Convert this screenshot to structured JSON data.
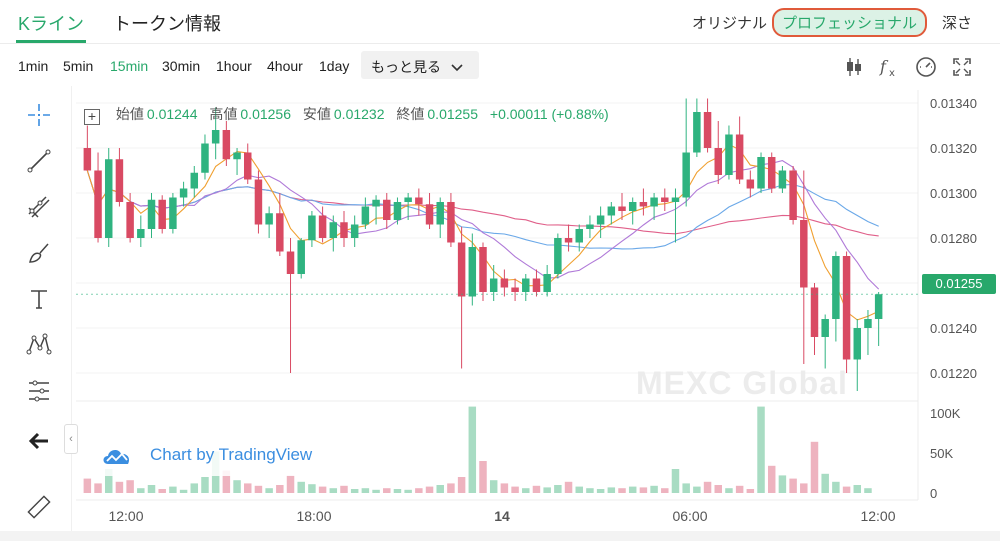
{
  "tabs": {
    "kline": "Kライン",
    "token_info": "トークン情報"
  },
  "view_options": {
    "original": "オリジナル",
    "professional": "プロフェッショナル",
    "depth": "深さ"
  },
  "intervals": [
    "1min",
    "5min",
    "15min",
    "30min",
    "1hour",
    "4hour",
    "1day"
  ],
  "active_interval": "15min",
  "more_label": "もっと見る",
  "legend": {
    "open_label": "始値",
    "open": "0.01244",
    "high_label": "高値",
    "high": "0.01256",
    "low_label": "安値",
    "low": "0.01232",
    "close_label": "終値",
    "close": "0.01255",
    "change": "+0.00011 (+0.88%)"
  },
  "current_price": "0.01255",
  "watermark": "MEXC Global",
  "tradingview_badge": "Chart by TradingView",
  "colors": {
    "accent": "#28a86b",
    "up": "#2fb380",
    "down": "#d94a63",
    "volume_up": "#a8dcc3",
    "volume_down": "#eeb3bf",
    "ma_pink": "#e0608a",
    "ma_blue": "#6aa8e8",
    "ma_orange": "#f0a030",
    "ma_purple": "#b07ad8"
  },
  "icons": [
    "candles-icon",
    "fx-icon",
    "gauge-icon",
    "fullscreen-icon",
    "crosshair-icon",
    "trendline-icon",
    "fib-icon",
    "brush-icon",
    "text-icon",
    "pattern-icon",
    "measure-icon",
    "back-arrow-icon",
    "ruler-icon"
  ],
  "chart_data": {
    "type": "candlestick",
    "price_axis_ticks": [
      "0.01340",
      "0.01320",
      "0.01300",
      "0.01280",
      "0.01260",
      "0.01240",
      "0.01220"
    ],
    "volume_axis_ticks": [
      "100K",
      "50K",
      "0"
    ],
    "time_axis_ticks": [
      "12:00",
      "18:00",
      "14",
      "06:00",
      "12:00"
    ],
    "ylim": [
      0.01208,
      0.01344
    ],
    "volume_max": 110000,
    "candles": [
      [
        0.0132,
        0.0133,
        0.01312,
        0.0131
      ],
      [
        0.0131,
        0.01318,
        0.01278,
        0.0128
      ],
      [
        0.0128,
        0.0132,
        0.01276,
        0.01315
      ],
      [
        0.01315,
        0.0132,
        0.01294,
        0.01296
      ],
      [
        0.01296,
        0.013,
        0.01278,
        0.0128
      ],
      [
        0.0128,
        0.0129,
        0.01276,
        0.01284
      ],
      [
        0.01284,
        0.013,
        0.0128,
        0.01297
      ],
      [
        0.01297,
        0.01299,
        0.01282,
        0.01284
      ],
      [
        0.01284,
        0.013,
        0.01282,
        0.01298
      ],
      [
        0.01298,
        0.01305,
        0.01294,
        0.01302
      ],
      [
        0.01302,
        0.01312,
        0.01298,
        0.01309
      ],
      [
        0.01309,
        0.01326,
        0.01306,
        0.01322
      ],
      [
        0.01322,
        0.01338,
        0.01315,
        0.01328
      ],
      [
        0.01328,
        0.01332,
        0.01312,
        0.01315
      ],
      [
        0.01315,
        0.0132,
        0.01308,
        0.01318
      ],
      [
        0.01318,
        0.01322,
        0.01304,
        0.01306
      ],
      [
        0.01306,
        0.0131,
        0.01282,
        0.01286
      ],
      [
        0.01286,
        0.01294,
        0.0128,
        0.01291
      ],
      [
        0.01291,
        0.013,
        0.01272,
        0.01274
      ],
      [
        0.01274,
        0.0128,
        0.0122,
        0.01264
      ],
      [
        0.01264,
        0.0128,
        0.01262,
        0.01279
      ],
      [
        0.01279,
        0.01292,
        0.01276,
        0.0129
      ],
      [
        0.0129,
        0.01294,
        0.01278,
        0.0128
      ],
      [
        0.0128,
        0.0129,
        0.01274,
        0.01287
      ],
      [
        0.01287,
        0.01292,
        0.01276,
        0.0128
      ],
      [
        0.0128,
        0.0129,
        0.01276,
        0.01286
      ],
      [
        0.01286,
        0.01298,
        0.01284,
        0.01294
      ],
      [
        0.01294,
        0.01299,
        0.01286,
        0.01297
      ],
      [
        0.01297,
        0.013,
        0.01284,
        0.01288
      ],
      [
        0.01288,
        0.01298,
        0.01286,
        0.01296
      ],
      [
        0.01296,
        0.013,
        0.01288,
        0.01298
      ],
      [
        0.01298,
        0.01302,
        0.0129,
        0.01295
      ],
      [
        0.01295,
        0.013,
        0.01284,
        0.01286
      ],
      [
        0.01286,
        0.01298,
        0.0128,
        0.01296
      ],
      [
        0.01296,
        0.013,
        0.01276,
        0.01278
      ],
      [
        0.01278,
        0.01285,
        0.01222,
        0.01254
      ],
      [
        0.01254,
        0.01282,
        0.0125,
        0.01276
      ],
      [
        0.01276,
        0.01278,
        0.01252,
        0.01256
      ],
      [
        0.01256,
        0.01268,
        0.01252,
        0.01262
      ],
      [
        0.01262,
        0.01266,
        0.01254,
        0.01258
      ],
      [
        0.01258,
        0.01262,
        0.01252,
        0.01256
      ],
      [
        0.01256,
        0.01264,
        0.01252,
        0.01262
      ],
      [
        0.01262,
        0.01266,
        0.01254,
        0.01256
      ],
      [
        0.01256,
        0.01268,
        0.01254,
        0.01264
      ],
      [
        0.01264,
        0.01282,
        0.01262,
        0.0128
      ],
      [
        0.0128,
        0.01286,
        0.01274,
        0.01278
      ],
      [
        0.01278,
        0.01286,
        0.01274,
        0.01284
      ],
      [
        0.01284,
        0.0129,
        0.0128,
        0.01286
      ],
      [
        0.01286,
        0.01294,
        0.0128,
        0.0129
      ],
      [
        0.0129,
        0.01296,
        0.01286,
        0.01294
      ],
      [
        0.01294,
        0.013,
        0.01288,
        0.01292
      ],
      [
        0.01292,
        0.01298,
        0.01286,
        0.01296
      ],
      [
        0.01296,
        0.01302,
        0.0129,
        0.01294
      ],
      [
        0.01294,
        0.013,
        0.01288,
        0.01298
      ],
      [
        0.01298,
        0.01302,
        0.01292,
        0.01296
      ],
      [
        0.01296,
        0.01302,
        0.01278,
        0.01298
      ],
      [
        0.01298,
        0.01342,
        0.01294,
        0.01318
      ],
      [
        0.01318,
        0.01342,
        0.01316,
        0.01336
      ],
      [
        0.01336,
        0.01342,
        0.01318,
        0.0132
      ],
      [
        0.0132,
        0.01332,
        0.01304,
        0.01308
      ],
      [
        0.01308,
        0.0133,
        0.01306,
        0.01326
      ],
      [
        0.01326,
        0.01334,
        0.01304,
        0.01306
      ],
      [
        0.01306,
        0.0131,
        0.01298,
        0.01302
      ],
      [
        0.01302,
        0.01318,
        0.013,
        0.01316
      ],
      [
        0.01316,
        0.01318,
        0.013,
        0.01302
      ],
      [
        0.01302,
        0.01312,
        0.013,
        0.0131
      ],
      [
        0.0131,
        0.01312,
        0.01286,
        0.01288
      ],
      [
        0.01288,
        0.0131,
        0.01224,
        0.01258
      ],
      [
        0.01258,
        0.0126,
        0.01228,
        0.01236
      ],
      [
        0.01236,
        0.01246,
        0.01222,
        0.01244
      ],
      [
        0.01244,
        0.01274,
        0.01234,
        0.01272
      ],
      [
        0.01272,
        0.01274,
        0.0122,
        0.01226
      ],
      [
        0.01226,
        0.01244,
        0.01212,
        0.0124
      ],
      [
        0.0124,
        0.01248,
        0.01228,
        0.01244
      ],
      [
        0.01244,
        0.01256,
        0.01232,
        0.01255
      ]
    ],
    "volumes": [
      18000,
      12000,
      30000,
      14000,
      16000,
      6000,
      10000,
      5000,
      8000,
      4000,
      12000,
      20000,
      52000,
      28000,
      16000,
      12000,
      9000,
      6000,
      10000,
      22000,
      14000,
      11000,
      8000,
      6000,
      9000,
      5000,
      6000,
      4000,
      6000,
      5000,
      4000,
      6000,
      8000,
      10000,
      12000,
      20000,
      108000,
      40000,
      16000,
      12000,
      8000,
      6000,
      9000,
      7000,
      10000,
      14000,
      8000,
      6000,
      5000,
      7000,
      6000,
      8000,
      7000,
      9000,
      6000,
      30000,
      12000,
      8000,
      14000,
      10000,
      6000,
      9000,
      5000,
      108000,
      34000,
      22000,
      18000,
      12000,
      64000,
      24000,
      14000,
      8000,
      10000,
      6000
    ]
  }
}
